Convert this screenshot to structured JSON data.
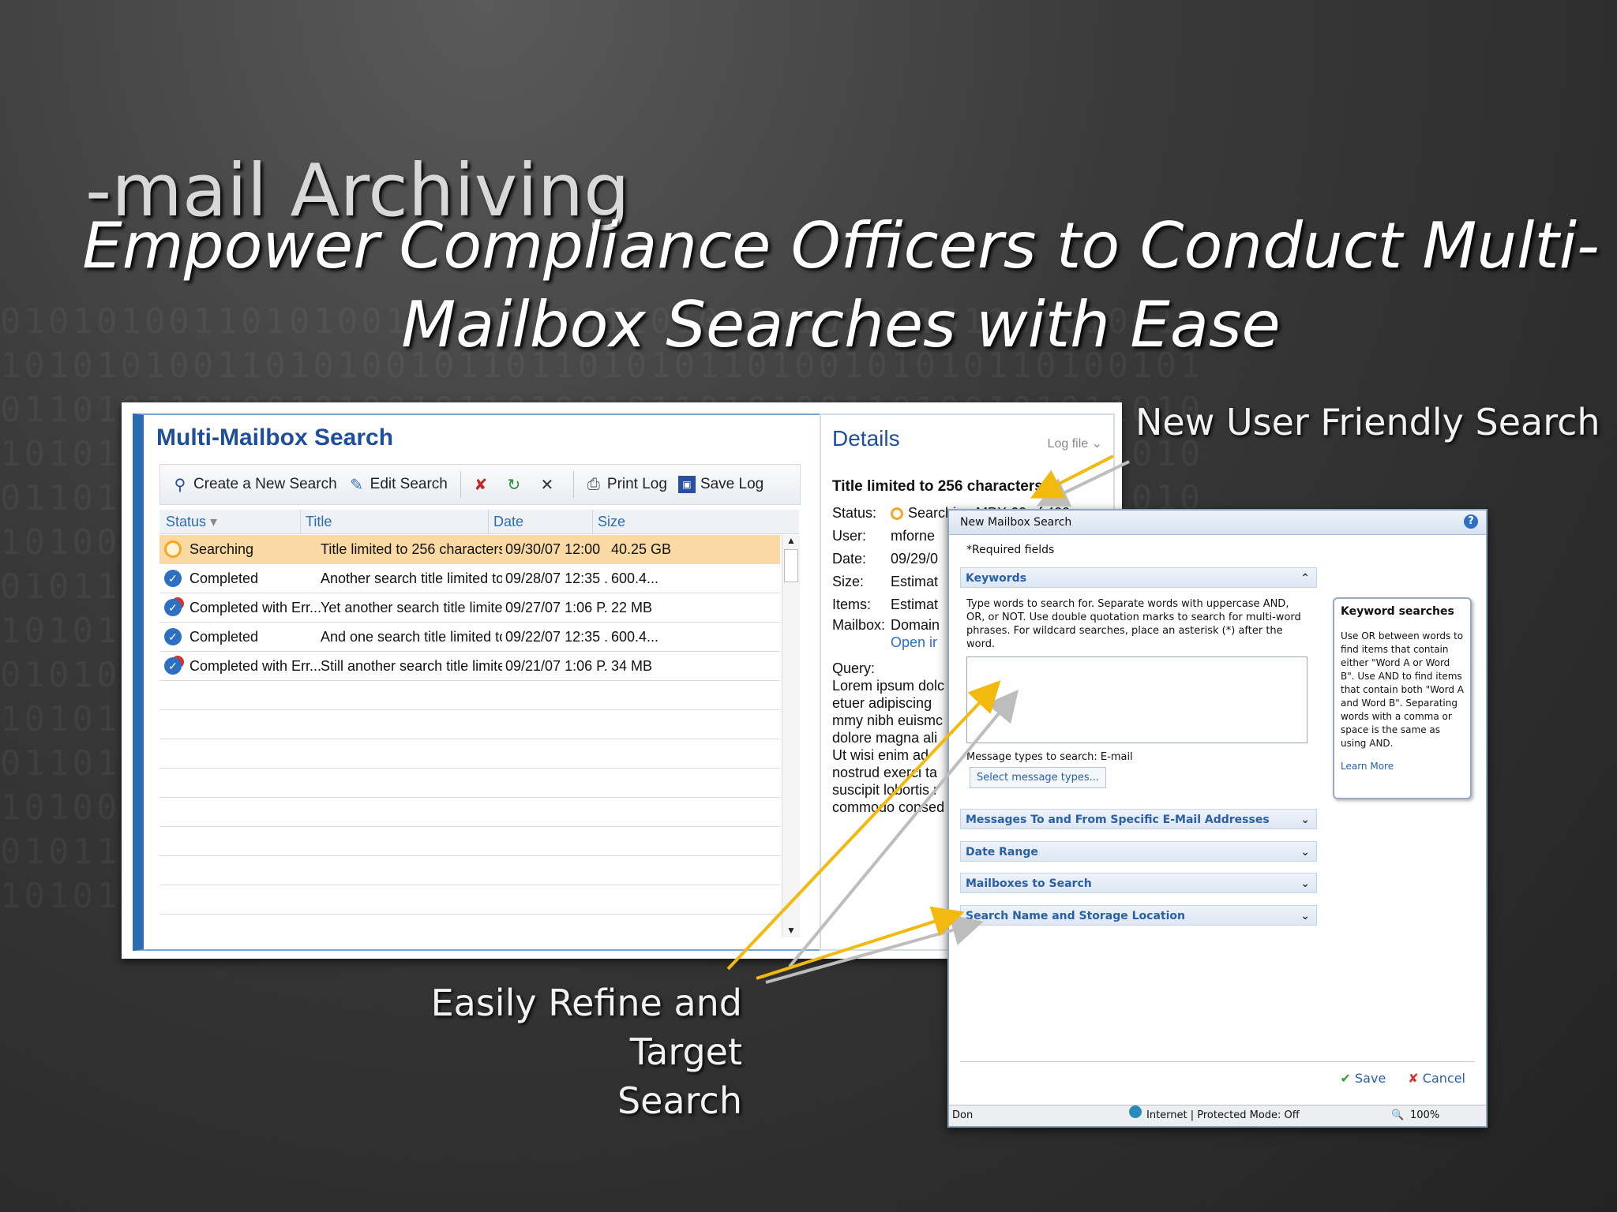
{
  "slide": {
    "title_back": "-mail Archiving",
    "headline_line1": "Empower Compliance Officers to Conduct Multi-",
    "headline_line2": "Mailbox Searches with Ease",
    "callout_top": "New User Friendly Search",
    "callout_bottom_line1": "Easily Refine and Target",
    "callout_bottom_line2": "Search",
    "arrow_color": "#f2b90f"
  },
  "mms": {
    "title": "Multi-Mailbox Search",
    "toolbar": {
      "create": "Create a New Search",
      "edit": "Edit Search",
      "print": "Print Log",
      "save": "Save Log"
    },
    "columns": {
      "status": "Status",
      "title": "Title",
      "date": "Date",
      "size": "Size"
    },
    "rows": [
      {
        "status": "Searching",
        "title": "Title limited to 256 characters",
        "date": "09/30/07 12:00",
        "size": "40.25 GB",
        "icon": "searching-icon"
      },
      {
        "status": "Completed",
        "title": "Another search title limited to 256...",
        "date": "09/28/07 12:35 ...",
        "size": "600.4...",
        "icon": "completed-icon"
      },
      {
        "status": "Completed with Err...",
        "title": "Yet another search title limited to...",
        "date": "09/27/07 1:06 P...",
        "size": "22 MB",
        "icon": "error-icon"
      },
      {
        "status": "Completed",
        "title": "And one search title limited to 256...",
        "date": "09/22/07 12:35 ...",
        "size": "600.4...",
        "icon": "completed-icon"
      },
      {
        "status": "Completed with Err...",
        "title": "Still another search title limited to...",
        "date": "09/21/07 1:06 P...",
        "size": "34 MB",
        "icon": "error-icon"
      }
    ]
  },
  "details": {
    "title": "Details",
    "log": "Log file",
    "heading": "Title limited to 256 characters",
    "status_label": "Status:",
    "status_value": "Searching MBX 60 of 400",
    "user_label": "User:",
    "user_value": "mforne",
    "date_label": "Date:",
    "date_value": "09/29/0",
    "size_label": "Size:",
    "size_value": "Estimat",
    "items_label": "Items:",
    "items_value": "Estimat",
    "mailbox_label": "Mailbox:",
    "mailbox_value": "Domain",
    "open_link": "Open ir",
    "query_label": "Query:",
    "query_lines": [
      "Lorem ipsum dolc",
      "etuer adipiscing",
      "mmy nibh euismc",
      "dolore magna ali",
      "Ut wisi enim ad",
      "nostrud exerci ta",
      "suscipit lobortis r",
      "commodo consed"
    ]
  },
  "dialog": {
    "title": "New Mailbox Search",
    "required": "*Required fields",
    "keywords": "Keywords",
    "keywords_desc": "Type words to search for. Separate words with uppercase AND, OR, or NOT. Use double quotation marks to search for multi-word phrases. For wildcard searches, place an asterisk (*) after the word.",
    "message_types": "Message types to search: E-mail",
    "select_types": "Select message types...",
    "sections": [
      "Messages To and From Specific E-Mail Addresses",
      "Date Range",
      "Mailboxes to Search",
      "Search Name and Storage Location"
    ],
    "tip_title": "Keyword searches",
    "tip_body": "Use OR between words to find items that contain either \"Word A or Word B\". Use AND to find items that contain both \"Word A and Word B\". Separating words with a comma or space is the same as using AND.",
    "tip_more": "Learn More",
    "save": "Save",
    "cancel": "Cancel",
    "status_done": "Don",
    "status_zone": "Internet | Protected Mode: Off",
    "status_zoom": "100%"
  }
}
